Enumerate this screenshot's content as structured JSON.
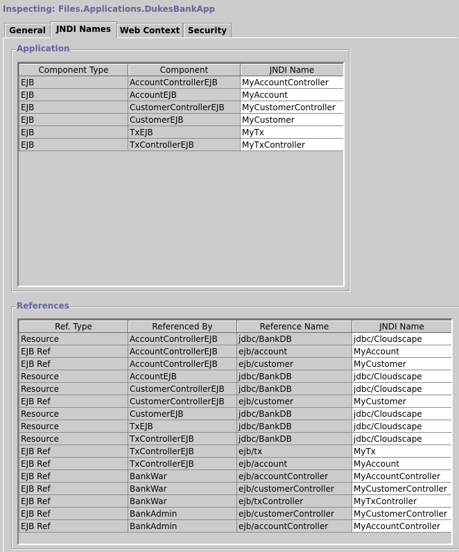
{
  "window": {
    "title": "Inspecting: Files.Applications.DukesBankApp"
  },
  "tabs": [
    {
      "label": "General",
      "active": false
    },
    {
      "label": "JNDI Names",
      "active": true
    },
    {
      "label": "Web Context",
      "active": false
    },
    {
      "label": "Security",
      "active": false
    }
  ],
  "application": {
    "legend": "Application",
    "columns": [
      "Component Type",
      "Component",
      "JNDI Name"
    ],
    "rows": [
      [
        "EJB",
        "AccountControllerEJB",
        "MyAccountController"
      ],
      [
        "EJB",
        "AccountEJB",
        "MyAccount"
      ],
      [
        "EJB",
        "CustomerControllerEJB",
        "MyCustomerController"
      ],
      [
        "EJB",
        "CustomerEJB",
        "MyCustomer"
      ],
      [
        "EJB",
        "TxEJB",
        "MyTx"
      ],
      [
        "EJB",
        "TxControllerEJB",
        "MyTxController"
      ]
    ]
  },
  "references": {
    "legend": "References",
    "columns": [
      "Ref. Type",
      "Referenced By",
      "Reference Name",
      "JNDI Name"
    ],
    "rows": [
      [
        "Resource",
        "AccountControllerEJB",
        "jdbc/BankDB",
        "jdbc/Cloudscape"
      ],
      [
        "EJB Ref",
        "AccountControllerEJB",
        "ejb/account",
        "MyAccount"
      ],
      [
        "EJB Ref",
        "AccountControllerEJB",
        "ejb/customer",
        "MyCustomer"
      ],
      [
        "Resource",
        "AccountEJB",
        "jdbc/BankDB",
        "jdbc/Cloudscape"
      ],
      [
        "Resource",
        "CustomerControllerEJB",
        "jdbc/BankDB",
        "jdbc/Cloudscape"
      ],
      [
        "EJB Ref",
        "CustomerControllerEJB",
        "ejb/customer",
        "MyCustomer"
      ],
      [
        "Resource",
        "CustomerEJB",
        "jdbc/BankDB",
        "jdbc/Cloudscape"
      ],
      [
        "Resource",
        "TxEJB",
        "jdbc/BankDB",
        "jdbc/Cloudscape"
      ],
      [
        "Resource",
        "TxControllerEJB",
        "jdbc/BankDB",
        "jdbc/Cloudscape"
      ],
      [
        "EJB Ref",
        "TxControllerEJB",
        "ejb/tx",
        "MyTx"
      ],
      [
        "EJB Ref",
        "TxControllerEJB",
        "ejb/account",
        "MyAccount"
      ],
      [
        "EJB Ref",
        "BankWar",
        "ejb/accountController",
        "MyAccountController"
      ],
      [
        "EJB Ref",
        "BankWar",
        "ejb/customerController",
        "MyCustomerController"
      ],
      [
        "EJB Ref",
        "BankWar",
        "ejb/txController",
        "MyTxController"
      ],
      [
        "EJB Ref",
        "BankAdmin",
        "ejb/customerController",
        "MyCustomerController"
      ],
      [
        "EJB Ref",
        "BankAdmin",
        "ejb/accountController",
        "MyAccountController"
      ]
    ]
  }
}
